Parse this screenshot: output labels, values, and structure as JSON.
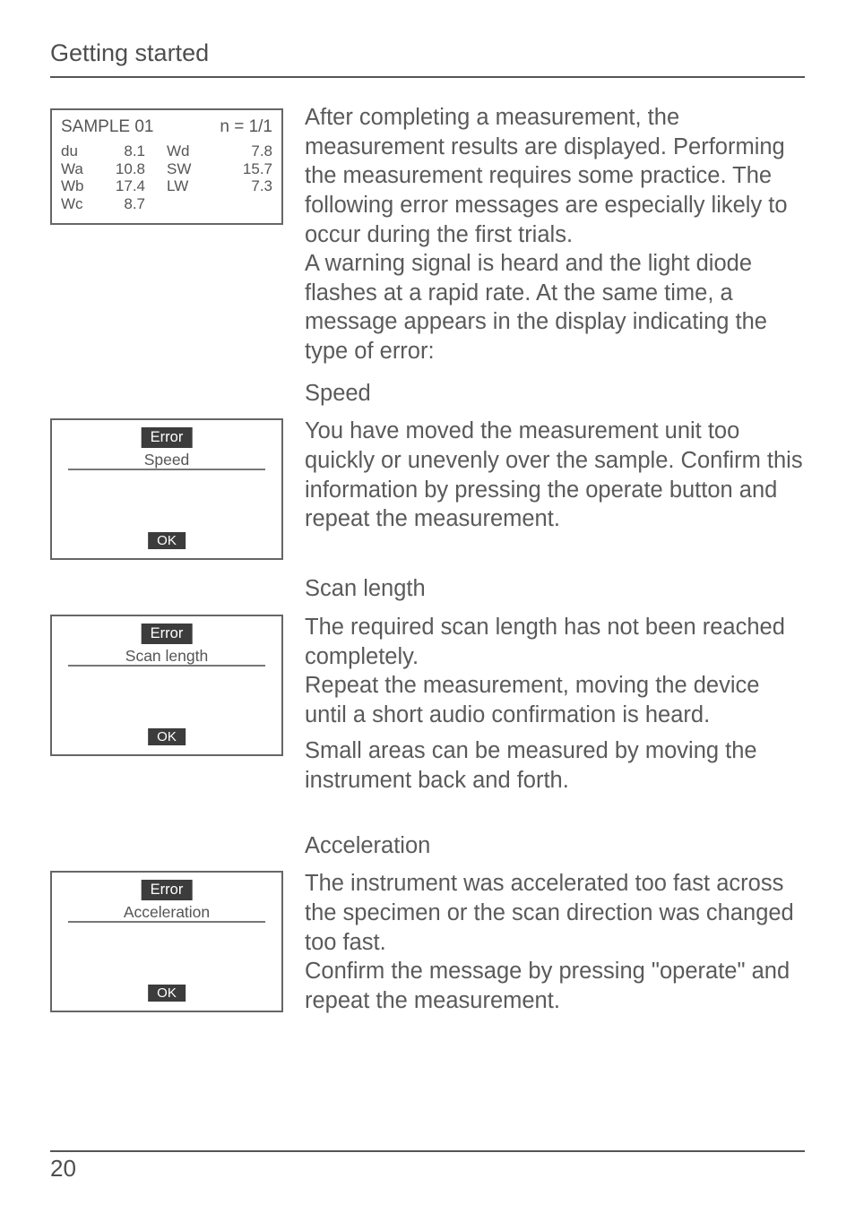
{
  "header": {
    "section_title": "Getting started"
  },
  "footer": {
    "page_number": "20"
  },
  "sample_display": {
    "title": "SAMPLE  01",
    "n_label": "n  =  1/1",
    "rows_left": [
      {
        "label": "du",
        "value": "8.1"
      },
      {
        "label": "Wa",
        "value": "10.8"
      },
      {
        "label": "Wb",
        "value": "17.4"
      },
      {
        "label": "Wc",
        "value": "8.7"
      }
    ],
    "rows_right": [
      {
        "label": "Wd",
        "value": "7.8"
      },
      {
        "label": "SW",
        "value": "15.7"
      },
      {
        "label": "LW",
        "value": "7.3"
      }
    ]
  },
  "intro_paragraph": "After completing a measurement, the measurement results are displayed. Performing the measurement requires some practice. The following error messages are especially likely to occur during the first trials.\nA warning signal is heard and the light diode flashes at a rapid rate. At the same time, a message appears in the display indicating the type of error:",
  "speed": {
    "title": "Speed",
    "dialog": {
      "badge": "Error",
      "type": "Speed",
      "ok": "OK"
    },
    "paragraph": "You have moved the measurement unit too quickly or unevenly over the sample. Confirm this information by pressing the operate button and repeat the measurement."
  },
  "scan_length": {
    "title": "Scan length",
    "dialog": {
      "badge": "Error",
      "type": "Scan length",
      "ok": "OK"
    },
    "paragraph_1": "The required scan length has not been reached completely.\nRepeat the measurement, moving the device until a short audio confirmation is heard.",
    "paragraph_2": "Small areas can be measured by moving the instrument back and forth."
  },
  "acceleration": {
    "title": "Acceleration",
    "dialog": {
      "badge": "Error",
      "type": "Acceleration",
      "ok": "OK"
    },
    "paragraph": "The instrument was accelerated too fast across the specimen or the scan direction was changed too fast.\nConfirm the message by pressing \"operate\" and repeat the measurement."
  }
}
